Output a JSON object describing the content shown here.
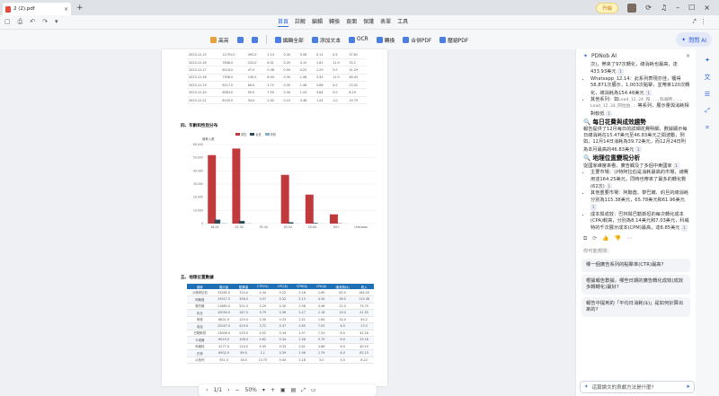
{
  "tab": {
    "title": "2 (2).pdf"
  },
  "window": {
    "upgrade": "升級"
  },
  "menus": [
    "首頁",
    "註解",
    "編輯",
    "轉換",
    "頁面",
    "保護",
    "表單",
    "工具"
  ],
  "tools": [
    {
      "label": "高亮",
      "icon": "highlight-icon"
    },
    {
      "label": "",
      "icon": "underline-icon"
    },
    {
      "label": "",
      "icon": "strikeout-icon"
    },
    {
      "label": "編輯全部",
      "icon": "edit-all-icon"
    },
    {
      "label": "添加文本",
      "icon": "add-text-icon"
    },
    {
      "label": "OCR",
      "icon": "ocr-icon"
    },
    {
      "label": "轉換",
      "icon": "convert-icon"
    },
    {
      "label": "合併PDF",
      "icon": "merge-pdf-icon"
    },
    {
      "label": "壓縮PDF",
      "icon": "compress-pdf-icon"
    }
  ],
  "ask_button": "問問 AI",
  "doc": {
    "daily_rows": [
      [
        "2023-12-15",
        "11791.0",
        "492.0",
        "2.14",
        "0.30",
        "0.08",
        "0.11",
        "0.5",
        "37.81"
      ],
      [
        "2023-12-16",
        "7836.0",
        "232.0",
        "6.01",
        "0.20",
        "0.15",
        "1.61",
        "11.0",
        "33.2"
      ],
      [
        "2023-12-17",
        "8116.0",
        "47.0",
        "0.38",
        "0.55",
        "0.22",
        "1.29",
        "2.0",
        "31.29"
      ],
      [
        "2023-12-18",
        "7306.0",
        "140.0",
        "6.04",
        "0.30",
        "1.96",
        "3.35",
        "11.0",
        "46.43"
      ],
      [
        "2023-12-19",
        "6117.0",
        "84.0",
        "2.72",
        "0.35",
        "1.46",
        "3.66",
        "4.0",
        "23.52"
      ],
      [
        "2023-12-20",
        "6063.0",
        "90.0",
        "7.50",
        "0.30",
        "1.53",
        "3.84",
        "5.0",
        "8.19"
      ],
      [
        "2023-12-21",
        "8150.0",
        "54.0",
        "2.02",
        "0.15",
        "0.46",
        "1.42",
        "1.0",
        "19.79"
      ]
    ],
    "sec4_title": "四、年齡和性別分布",
    "sec5_title": "五、地理位置數據",
    "geo_headers": [
      "國家",
      "展示量",
      "點擊量",
      "CTR(%)",
      "CPC($)",
      "CPM($)",
      "CPA($)",
      "總消費($)",
      "收入"
    ],
    "geo_rows": [
      [
        "沙特阿拉伯",
        "33281.0",
        "724.0",
        "4.34",
        "0.22",
        "2.16",
        "2.65",
        "62.0",
        "164.25"
      ],
      [
        "阿聯酋",
        "19317.0",
        "336.0",
        "3.07",
        "0.32",
        "2.13",
        "4.34",
        "36.0",
        "115.38"
      ],
      [
        "黎巴嫩",
        "11685.0",
        "251.0",
        "5.29",
        "0.30",
        "2.98",
        "3.46",
        "21.0",
        "73.75"
      ],
      [
        "約旦",
        "10030.0",
        "167.0",
        "3.79",
        "0.36",
        "2.27",
        "2.16",
        "19.0",
        "41.55"
      ],
      [
        "阿曼",
        "8621.0",
        "129.0",
        "5.30",
        "0.33",
        "2.51",
        "1.64",
        "14.0",
        "40.2"
      ],
      [
        "埃及",
        "20247.0",
        "419.0",
        "3.72",
        "0.37",
        "2.65",
        "7.03",
        "6.0",
        "23.5"
      ],
      [
        "巴勒斯坦",
        "13006.0",
        "239.0",
        "4.52",
        "0.34",
        "1.97",
        "7.53",
        "6.0",
        "42.16"
      ],
      [
        "卡塔爾",
        "6019.0",
        "106.0",
        "4.62",
        "0.34",
        "1.58",
        "5.79",
        "6.0",
        "25.18"
      ],
      [
        "科威特",
        "4177.0",
        "114.0",
        "4.05",
        "0.33",
        "2.61",
        "3.86",
        "6.0",
        "40.19"
      ],
      [
        "巴林",
        "6902.0",
        "89.0",
        "1.1",
        "0.39",
        "1.96",
        "1.79",
        "6.0",
        "62.15"
      ],
      [
        "以色列",
        "551.0",
        "16.0",
        "13.75",
        "0.44",
        "2.18",
        "3.0",
        "4.0",
        "8.22"
      ]
    ],
    "zoom": "50%",
    "page": "1/1"
  },
  "chart_data": {
    "type": "bar",
    "ylabel": "總參入數",
    "legend": [
      "男性",
      "女性",
      "未知"
    ],
    "categories": [
      "18-24",
      "25-34",
      "35-44",
      "45-54",
      "55-64",
      "65+",
      "Unknown"
    ],
    "series": [
      {
        "name": "男性",
        "values": [
          52000,
          57000,
          0,
          37000,
          22000,
          7000,
          0
        ]
      },
      {
        "name": "女性",
        "values": [
          3000,
          2000,
          0,
          1000,
          500,
          200,
          0
        ]
      },
      {
        "name": "未知",
        "values": [
          300,
          200,
          0,
          100,
          100,
          50,
          0
        ]
      }
    ],
    "yticks": [
      "0",
      "10,000",
      "20,000",
      "30,000",
      "40,000",
      "50,000",
      "60,000"
    ],
    "ylim": [
      0,
      60000
    ],
    "colors": {
      "男性": "#c0393b",
      "女性": "#2c4a5a",
      "未知": "#7fb3c8"
    }
  },
  "panel": {
    "title": "PDNob AI",
    "intro": "次)，帶來了97次轉化，總消耗也最高，達433.93美元",
    "whatsapp": "Whatsapp_12.14：此系列表現亦佳，獲得58,871次展示，1,003次點擊，並帶來120次轉化，總消耗為154.46美元",
    "other": "其他系列：如",
    "other_mono": "Lead_12.24_和...,科威特..., Lead_12.24_阿拉伯...",
    "other_tail": "等系列，展示量與消耗相對較低",
    "daily_title": "每日花費與成效趨勢",
    "daily_text": "報告提供了12月每日的詳細花費明細，數據顯示每日總消耗在15.47美元至46.83美元之間波動，例如，12月14日消耗為39.72美元，而12月24日則為本月最高的46.83美元",
    "geo_title": "地理位置變現分析",
    "geo_intro": "從國家維度來看，廣告觸及了多個中東國家",
    "geo_main": "主要市場：沙特阿拉伯是消耗最高的市場，總費用達164.25美元，同時也帶來了最多的轉化數(62次)",
    "geo_other": "其他重要市場：阿聯酋、黎巴嫩、約旦的總消耗分別為115.38美元，65.78美元和61.96美元",
    "geo_cost": "成本與成效：巴林與巴勒斯坦的每次轉化成本(CPA)較高，分別為8.14美元和7.03美元，科威特的千次展示成本(CPM)最高，達8.85美元",
    "suggest_label": "你可能想問：",
    "suggestions": [
      "哪一個廣告系列的點擊率(CTR)最高?",
      "根據報告數據，哪些日期的廣告轉化成效(成效多轉轉化)最好?",
      "報告中提到的「平均日消耗($)」是如何計算出來的?"
    ],
    "input_placeholder": "這篇論文的貢獻方法是什麼?"
  }
}
